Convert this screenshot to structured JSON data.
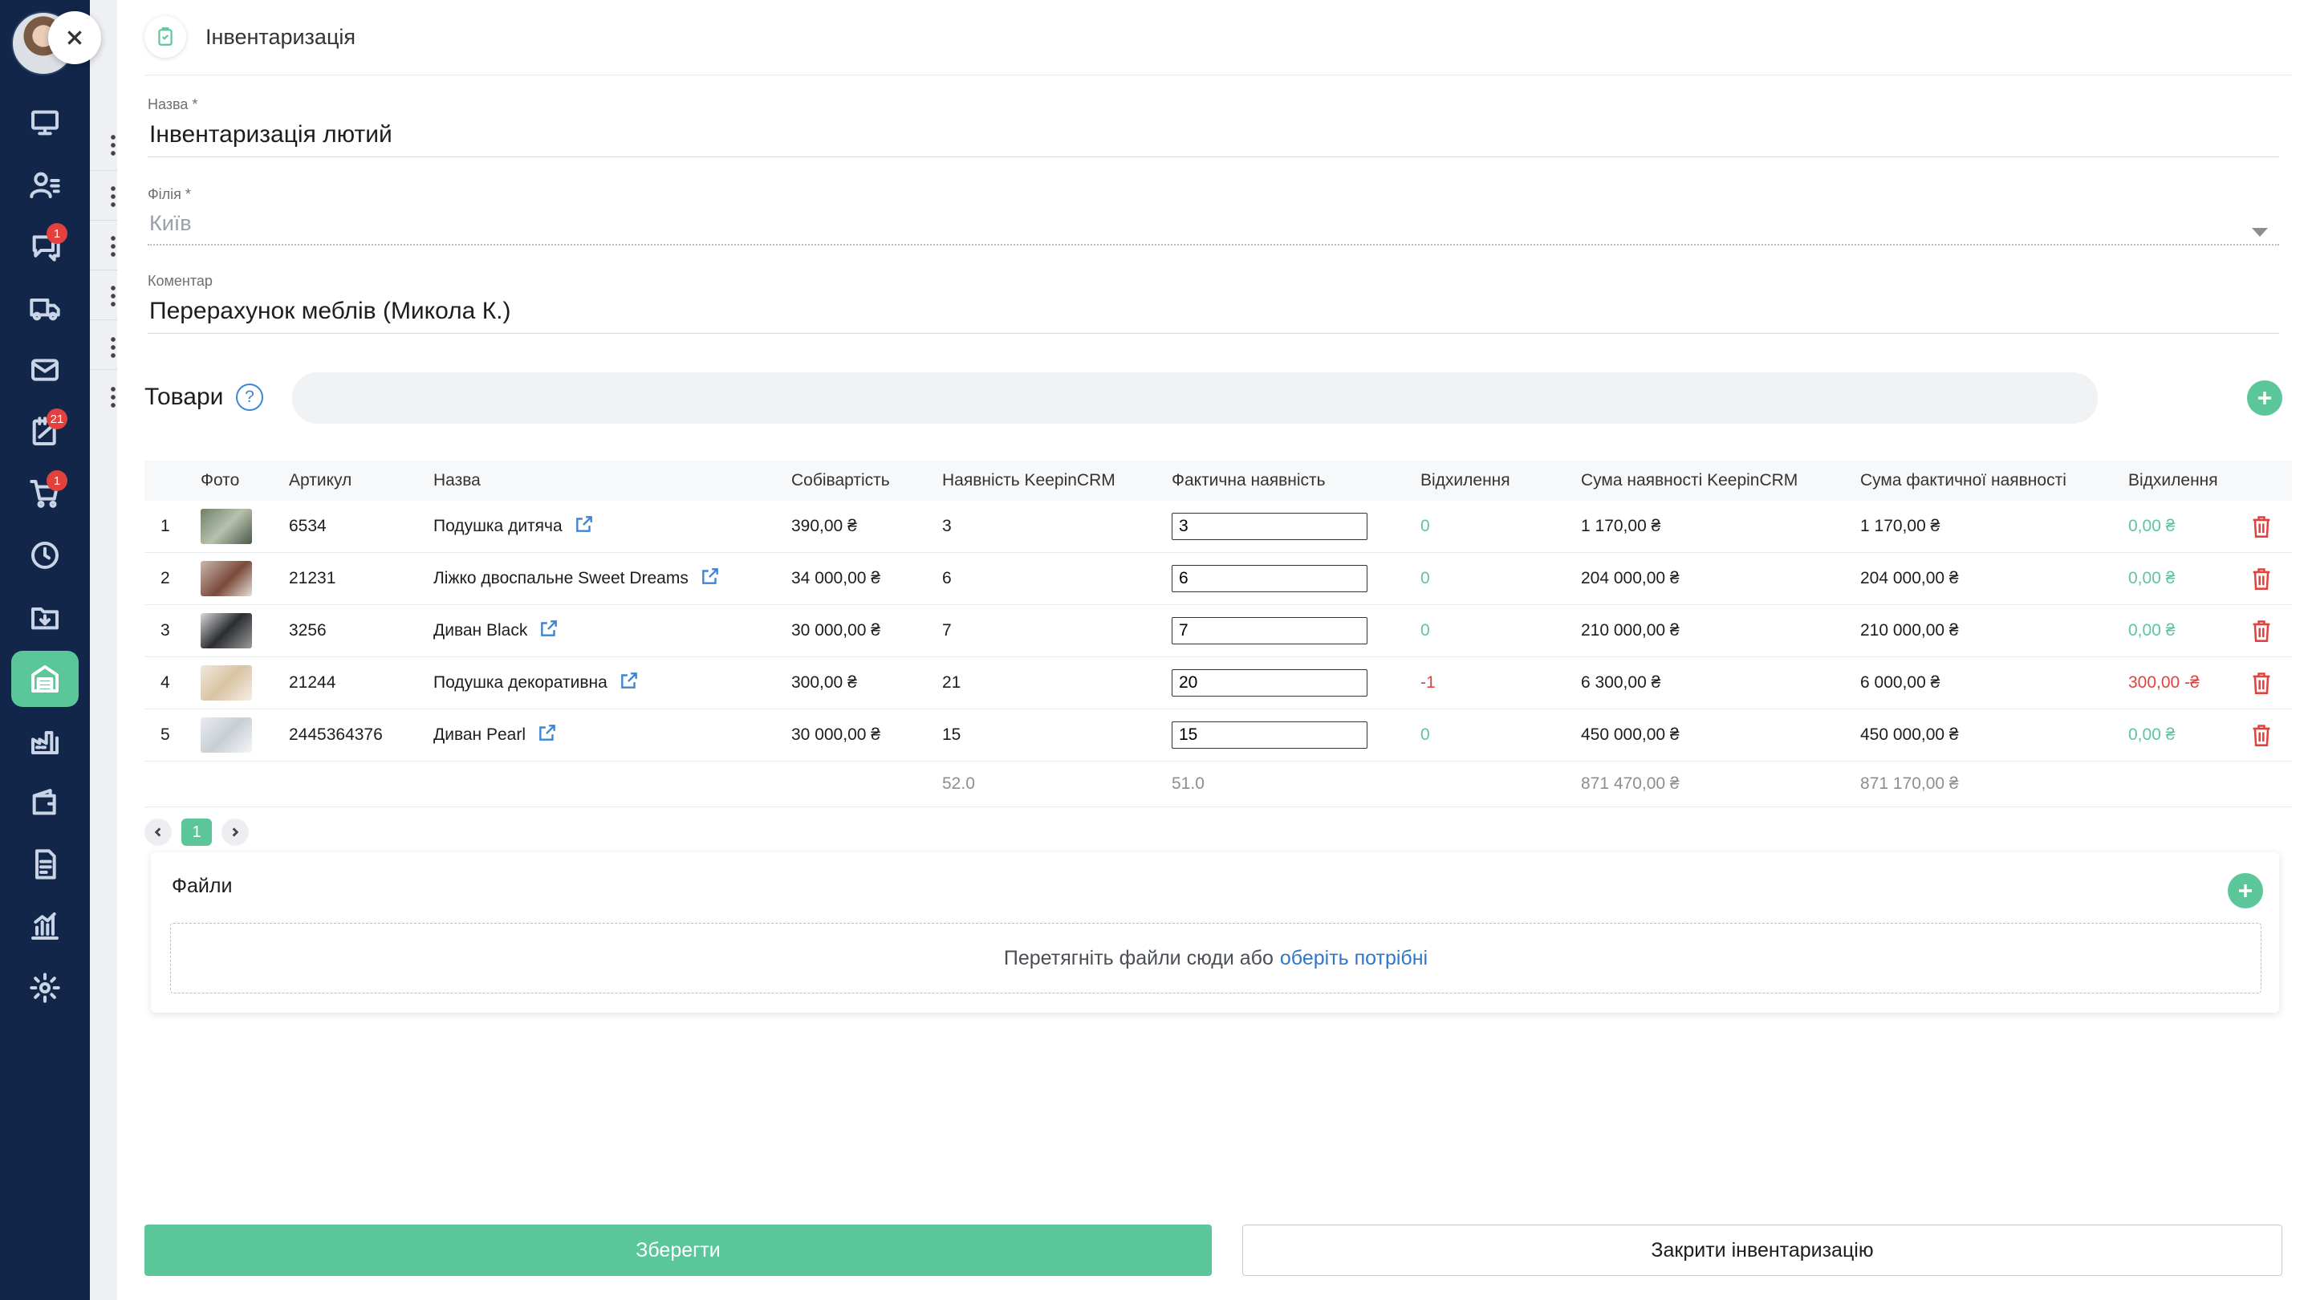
{
  "sidebar": {
    "items": [
      {
        "name": "dashboard",
        "icon": "monitor-icon",
        "badge": ""
      },
      {
        "name": "contacts",
        "icon": "user-list-icon",
        "badge": ""
      },
      {
        "name": "chats",
        "icon": "chat-icon",
        "badge": "1"
      },
      {
        "name": "delivery",
        "icon": "truck-icon",
        "badge": ""
      },
      {
        "name": "mail",
        "icon": "mail-icon",
        "badge": ""
      },
      {
        "name": "tasks",
        "icon": "notepad-icon",
        "badge": "21"
      },
      {
        "name": "orders",
        "icon": "cart-icon",
        "badge": "1"
      },
      {
        "name": "history",
        "icon": "clock-icon",
        "badge": ""
      },
      {
        "name": "import",
        "icon": "folder-download-icon",
        "badge": ""
      },
      {
        "name": "warehouse",
        "icon": "warehouse-icon",
        "badge": "",
        "active": true
      },
      {
        "name": "production",
        "icon": "factory-icon",
        "badge": ""
      },
      {
        "name": "finance",
        "icon": "wallet-icon",
        "badge": ""
      },
      {
        "name": "documents",
        "icon": "document-icon",
        "badge": ""
      },
      {
        "name": "analytics",
        "icon": "chart-icon",
        "badge": ""
      },
      {
        "name": "settings",
        "icon": "gear-icon",
        "badge": ""
      }
    ]
  },
  "drawer": {
    "title": "Інвентаризація"
  },
  "form": {
    "name_label": "Назва *",
    "name_value": "Інвентаризація лютий",
    "branch_label": "Філія *",
    "branch_value": "Київ",
    "comment_label": "Коментар",
    "comment_value": "Перерахунок меблів (Микола К.)"
  },
  "goods": {
    "title": "Товари",
    "help": "?",
    "columns": [
      "Фото",
      "Артикул",
      "Назва",
      "Собівартість",
      "Наявність KeepinCRM",
      "Фактична наявність",
      "Відхилення",
      "Сума наявності KeepinCRM",
      "Сума фактичної наявності",
      "Відхилення"
    ],
    "rows": [
      {
        "num": "1",
        "sku": "6534",
        "name": "Подушка дитяча",
        "cost": "390,00 ₴",
        "stock": "3",
        "actual": "3",
        "diff": "0",
        "sum_stock": "1 170,00 ₴",
        "sum_actual": "1 170,00 ₴",
        "sum_diff": "0,00 ₴",
        "neg": false
      },
      {
        "num": "2",
        "sku": "21231",
        "name": "Ліжко двоспальне Sweet Dreams",
        "cost": "34 000,00 ₴",
        "stock": "6",
        "actual": "6",
        "diff": "0",
        "sum_stock": "204 000,00 ₴",
        "sum_actual": "204 000,00 ₴",
        "sum_diff": "0,00 ₴",
        "neg": false
      },
      {
        "num": "3",
        "sku": "3256",
        "name": "Диван Black",
        "cost": "30 000,00 ₴",
        "stock": "7",
        "actual": "7",
        "diff": "0",
        "sum_stock": "210 000,00 ₴",
        "sum_actual": "210 000,00 ₴",
        "sum_diff": "0,00 ₴",
        "neg": false
      },
      {
        "num": "4",
        "sku": "21244",
        "name": "Подушка декоративна",
        "cost": "300,00 ₴",
        "stock": "21",
        "actual": "20",
        "diff": "-1",
        "sum_stock": "6 300,00 ₴",
        "sum_actual": "6 000,00 ₴",
        "sum_diff": "300,00 -₴",
        "neg": true
      },
      {
        "num": "5",
        "sku": "2445364376",
        "name": "Диван Pearl",
        "cost": "30 000,00 ₴",
        "stock": "15",
        "actual": "15",
        "diff": "0",
        "sum_stock": "450 000,00 ₴",
        "sum_actual": "450 000,00 ₴",
        "sum_diff": "0,00 ₴",
        "neg": false
      }
    ],
    "totals": {
      "stock": "52.0",
      "actual": "51.0",
      "sum_stock": "871 470,00 ₴",
      "sum_actual": "871 170,00 ₴"
    }
  },
  "pagination": {
    "current": "1"
  },
  "files": {
    "title": "Файли",
    "drop_text": "Перетягніть файли сюди або",
    "drop_link": "оберіть потрібні"
  },
  "actions": {
    "save": "Зберегти",
    "close_inventory": "Закрити інвентаризацію"
  },
  "colors": {
    "accent": "#5cc69b",
    "sidebar": "#12264a",
    "danger": "#e3413d",
    "link": "#2f78c9"
  }
}
